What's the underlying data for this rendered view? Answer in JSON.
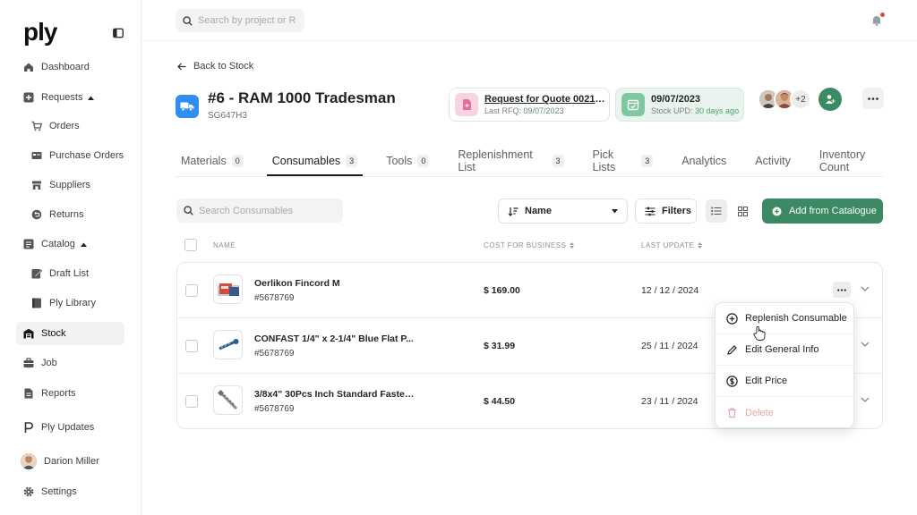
{
  "app": {
    "logo": "ply"
  },
  "sidebar": {
    "items": [
      {
        "label": "Dashboard",
        "icon": "home-icon"
      },
      {
        "label": "Requests",
        "icon": "plus-square-icon",
        "expanded": true
      },
      {
        "label": "Orders",
        "icon": "cart-icon"
      },
      {
        "label": "Purchase Orders",
        "icon": "card-icon"
      },
      {
        "label": "Suppliers",
        "icon": "store-icon"
      },
      {
        "label": "Returns",
        "icon": "return-icon"
      },
      {
        "label": "Catalog",
        "icon": "catalog-icon",
        "expanded": true
      },
      {
        "label": "Draft List",
        "icon": "draft-icon"
      },
      {
        "label": "Ply Library",
        "icon": "library-icon"
      },
      {
        "label": "Stock",
        "icon": "warehouse-icon",
        "active": true
      },
      {
        "label": "Job",
        "icon": "briefcase-icon"
      },
      {
        "label": "Reports",
        "icon": "report-icon"
      },
      {
        "label": "Ply Updates",
        "icon": "ply-mark-icon"
      },
      {
        "label": "Darion Miller",
        "icon": "avatar"
      },
      {
        "label": "Settings",
        "icon": "gear-icon"
      }
    ]
  },
  "topbar": {
    "search_placeholder": "Search by project or RFQ"
  },
  "page": {
    "back_label": "Back to Stock",
    "title": "#6 - RAM 1000 Tradesman",
    "subtitle": "SG647H3",
    "rfq_card": {
      "title": "Request for Quote 00213…",
      "sub_prefix": "Last RFQ:",
      "sub_value": "09/07/2023"
    },
    "stock_card": {
      "title": "09/07/2023",
      "sub_prefix": "Stock UPD:",
      "sub_value": "30 days ago"
    },
    "avatars_more": "+2"
  },
  "tabs": [
    {
      "label": "Materials",
      "count": "0"
    },
    {
      "label": "Consumables",
      "count": "3",
      "active": true
    },
    {
      "label": "Tools",
      "count": "0"
    },
    {
      "label": "Replenishment List",
      "count": "3"
    },
    {
      "label": "Pick Lists",
      "count": "3"
    },
    {
      "label": "Analytics"
    },
    {
      "label": "Activity"
    },
    {
      "label": "Inventory Count"
    }
  ],
  "toolbar": {
    "search_placeholder": "Search Consumables",
    "sort_label": "Name",
    "filters_label": "Filters",
    "add_label": "Add from Catalogue"
  },
  "table": {
    "columns": {
      "name": "NAME",
      "cost": "COST FOR BUSINESS",
      "updated": "LAST UPDATE"
    },
    "rows": [
      {
        "name": "Oerlikon Fincord M",
        "sku": "#5678769",
        "cost": "$ 169.00",
        "date": "12 / 12 / 2024"
      },
      {
        "name": "CONFAST 1/4\" x 2-1/4\" Blue Flat P...",
        "sku": "#5678769",
        "cost": "$ 31.99",
        "date": "25 / 11 / 2024"
      },
      {
        "name": "3/8x4\" 30Pcs Inch Standard Fasten...",
        "sku": "#5678769",
        "cost": "$ 44.50",
        "date": "23 / 11 / 2024"
      }
    ]
  },
  "menu": {
    "items": [
      {
        "label": "Replenish Consumable",
        "icon": "plus-circle-icon"
      },
      {
        "label": "Edit General Info",
        "icon": "pencil-icon"
      },
      {
        "label": "Edit Price",
        "icon": "dollar-icon"
      },
      {
        "label": "Delete",
        "icon": "trash-icon",
        "disabled": true
      }
    ]
  },
  "colors": {
    "accent": "#3c8a63",
    "truck_badge": "#2f8ef2",
    "stock_card_bg": "#e9f4ee",
    "rfq_icon_bg": "#f8d4e3",
    "danger_disabled": "#e3a9a4"
  }
}
